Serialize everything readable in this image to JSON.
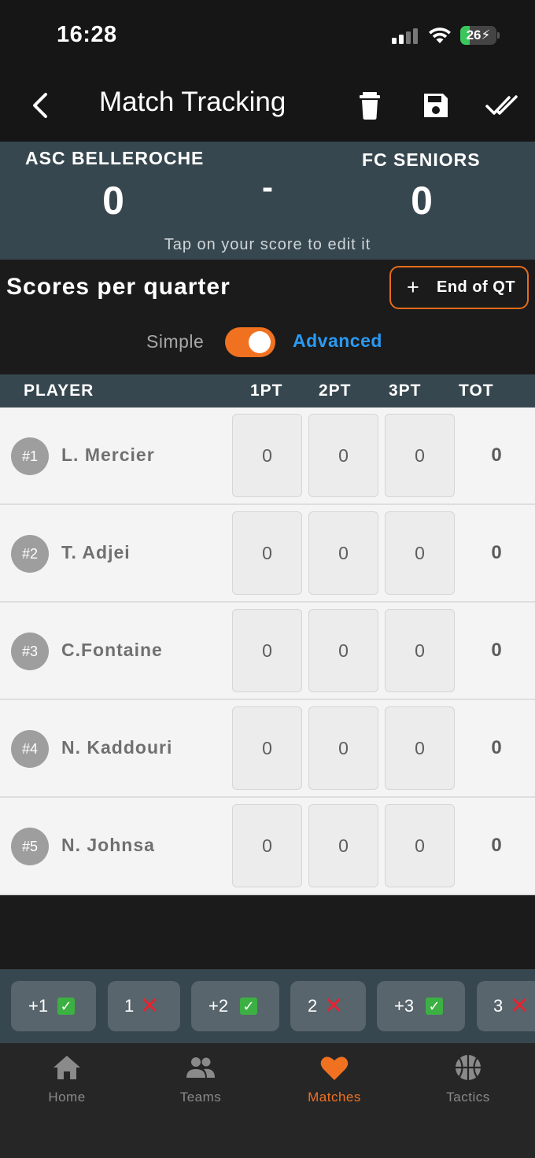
{
  "status_bar": {
    "time": "16:28",
    "battery": "26",
    "battery_level": 0.26
  },
  "nav": {
    "title": "Match Tracking"
  },
  "score": {
    "home_team": "ASC BELLEROCHE",
    "away_team": "FC SENIORS",
    "home_score": "0",
    "away_score": "0",
    "separator": "-",
    "hint": "Tap on your score to edit it"
  },
  "quarter": {
    "title": "Scores per quarter",
    "end_button_plus": "+",
    "end_button_label": "End of QT",
    "mode_simple": "Simple",
    "mode_advanced": "Advanced",
    "advanced_enabled": true
  },
  "table": {
    "headers": [
      "PLAYER",
      "1PT",
      "2PT",
      "3PT",
      "TOT"
    ],
    "rows": [
      {
        "number": "#1",
        "name": "L. Mercier",
        "pt1": "0",
        "pt2": "0",
        "pt3": "0",
        "tot": "0"
      },
      {
        "number": "#2",
        "name": "T. Adjei",
        "pt1": "0",
        "pt2": "0",
        "pt3": "0",
        "tot": "0"
      },
      {
        "number": "#3",
        "name": "C.Fontaine",
        "pt1": "0",
        "pt2": "0",
        "pt3": "0",
        "tot": "0"
      },
      {
        "number": "#4",
        "name": "N. Kaddouri",
        "pt1": "0",
        "pt2": "0",
        "pt3": "0",
        "tot": "0"
      },
      {
        "number": "#5",
        "name": "N. Johnsa",
        "pt1": "0",
        "pt2": "0",
        "pt3": "0",
        "tot": "0"
      }
    ]
  },
  "quick_actions": [
    {
      "label": "+1",
      "mark": "check"
    },
    {
      "label": "1",
      "mark": "cross"
    },
    {
      "label": "+2",
      "mark": "check"
    },
    {
      "label": "2",
      "mark": "cross"
    },
    {
      "label": "+3",
      "mark": "check"
    },
    {
      "label": "3",
      "mark": "cross"
    }
  ],
  "tabs": [
    {
      "label": "Home",
      "icon": "home-icon",
      "active": false
    },
    {
      "label": "Teams",
      "icon": "people-icon",
      "active": false
    },
    {
      "label": "Matches",
      "icon": "heart-icon",
      "active": true
    },
    {
      "label": "Tactics",
      "icon": "basketball-icon",
      "active": false
    }
  ],
  "colors": {
    "accent": "#f07221",
    "link": "#2b9af3",
    "panel": "#37474f",
    "check": "#3cb043",
    "cross": "#e6222e"
  }
}
